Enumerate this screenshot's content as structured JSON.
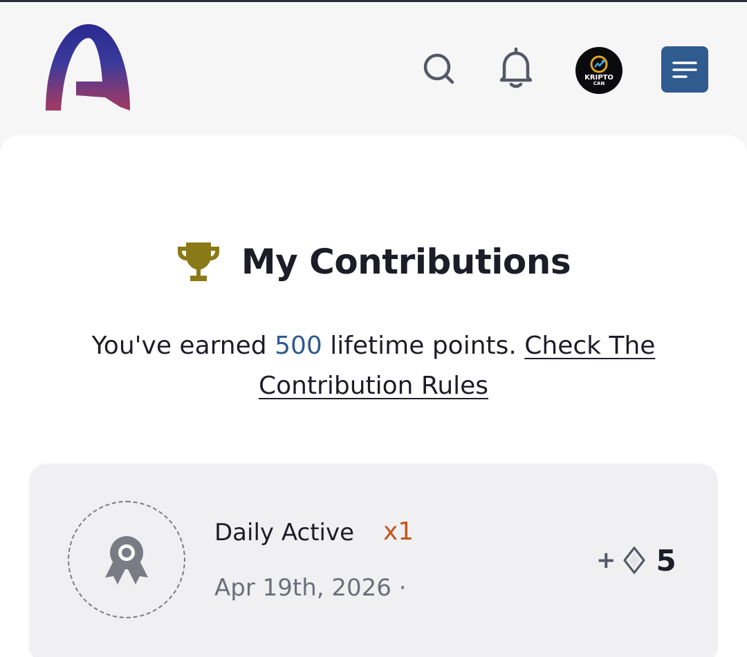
{
  "header": {
    "logo_icon": "brand-logo",
    "search_icon": "search-icon",
    "bell_icon": "bell-icon",
    "avatar": {
      "text": "KRIPTO",
      "sub": "CAN"
    },
    "menu_icon": "menu-icon"
  },
  "main": {
    "title": "My Contributions",
    "subtitle": {
      "prefix": "You've earned ",
      "points": "500",
      "middle": " lifetime points. ",
      "link": "Check The Contribution Rules"
    }
  },
  "contribution": {
    "name": "Daily Active",
    "multiplier": "x1",
    "date": "Apr 19th, 2026 ·",
    "reward_sign": "+",
    "reward_value": "5",
    "badge_icon": "award-ribbon-icon",
    "gem_icon": "diamond-icon"
  },
  "colors": {
    "accent": "#2f5b8f",
    "trophy": "#8a7a17",
    "multiplier": "#c2561a",
    "text": "#1d1d28",
    "muted": "#6b6f7b"
  }
}
